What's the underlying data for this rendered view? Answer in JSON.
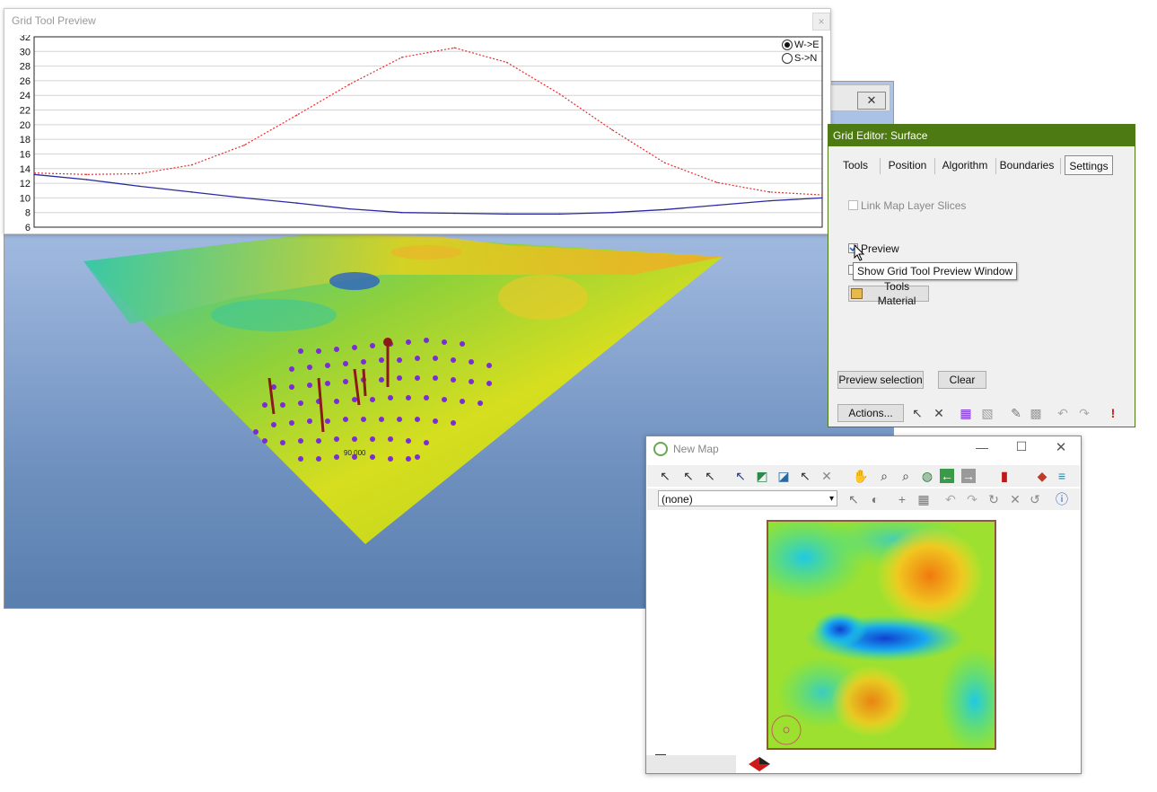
{
  "preview_window": {
    "title": "Grid Tool Preview",
    "close": "×",
    "directions": [
      {
        "label": "W->E",
        "selected": true
      },
      {
        "label": "S->N",
        "selected": false
      }
    ]
  },
  "chart_data": {
    "type": "line",
    "x": [
      0,
      1,
      2,
      3,
      4,
      5,
      6,
      7,
      8,
      9,
      10,
      11,
      12,
      13,
      14,
      15
    ],
    "yticks": [
      "6",
      "8",
      "10",
      "12",
      "14",
      "16",
      "18",
      "20",
      "22",
      "24",
      "26",
      "28",
      "30",
      "32"
    ],
    "ylim": [
      6,
      32
    ],
    "grid": true,
    "series": [
      {
        "values": [
          13.4,
          13.2,
          13.3,
          14.5,
          17.2,
          21.3,
          25.5,
          29.2,
          30.5,
          28.5,
          24.2,
          19.3,
          14.8,
          12.1,
          10.8,
          10.4
        ],
        "color": "#e03030",
        "style": "dotted"
      },
      {
        "values": [
          13.2,
          12.5,
          11.6,
          10.8,
          10.0,
          9.3,
          8.5,
          8.0,
          7.9,
          7.8,
          7.8,
          8.0,
          8.4,
          9.0,
          9.6,
          10.0
        ],
        "color": "#2a2aa0",
        "style": "solid"
      }
    ]
  },
  "grid_editor": {
    "title": "Grid Editor: Surface",
    "tabs": [
      "Tools",
      "Position",
      "Algorithm",
      "Boundaries",
      "Settings"
    ],
    "active_tab": "Settings",
    "link_map_layer_slices": "Link Map Layer Slices",
    "preview": "Preview",
    "tooltip": "Show Grid Tool Preview Window",
    "tools_material": "Tools Material",
    "preview_selection": "Preview selection",
    "clear": "Clear",
    "actions": "Actions..."
  },
  "new_map": {
    "title": "New Map",
    "layer_select": "(none)",
    "colors": {
      "accent": "#4d7a13"
    }
  },
  "scene_label": "90.000"
}
